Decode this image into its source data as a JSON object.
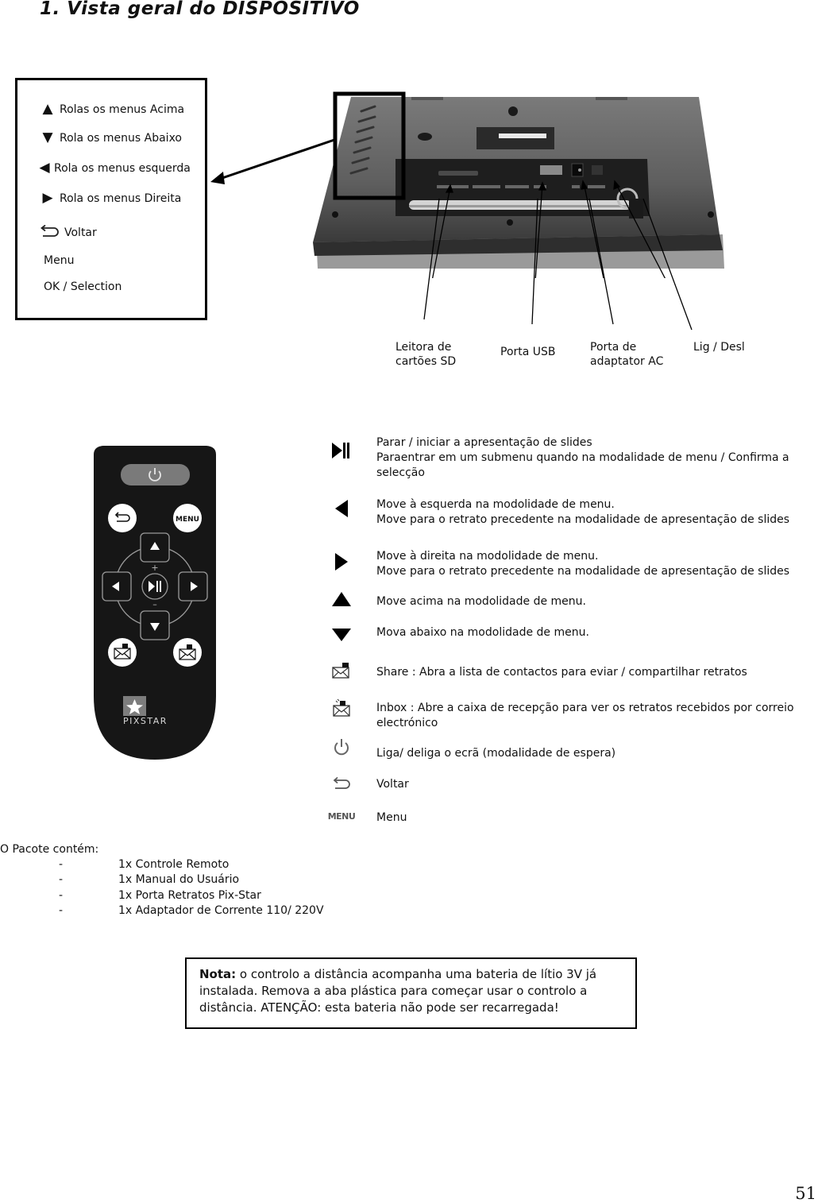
{
  "page": {
    "title": "1. Vista geral do DISPOSITIVO",
    "page_number": "51"
  },
  "device_buttons_legend": {
    "items": [
      {
        "icon": "up-triangle-icon",
        "glyph": "▲",
        "label": "Rolas os menus Acima"
      },
      {
        "icon": "down-triangle-icon",
        "glyph": "▼",
        "label": "Rola os menus Abaixo"
      },
      {
        "icon": "left-triangle-icon",
        "glyph": "◀",
        "label": "Rola os menus esquerda"
      },
      {
        "icon": "right-triangle-icon",
        "glyph": "▶",
        "label": "Rola os menus Direita"
      },
      {
        "icon": "back-arrow-icon",
        "glyph": "⮌",
        "label": "Voltar"
      },
      {
        "icon": "",
        "glyph": "",
        "label": "Menu"
      },
      {
        "icon": "",
        "glyph": "",
        "label": "OK /  Selection"
      }
    ]
  },
  "device_ports": {
    "sd_reader": {
      "line1": "Leitora de",
      "line2": "cartões SD"
    },
    "usb_port": {
      "line1": "Porta USB"
    },
    "ac_adapter": {
      "line1": "Porta de",
      "line2": "adaptator AC"
    },
    "power_switch": {
      "line1": "Lig /  Desl"
    }
  },
  "remote": {
    "menu_button_label": "MENU",
    "brand": "PIXSTAR",
    "plus": "+",
    "minus": "–"
  },
  "remote_functions": [
    {
      "icon": "play-pause-icon",
      "lines": [
        "Parar /  iniciar a apresentação de slides",
        "Paraentrar em um submenu quando na modalidade de menu /  Confirma a",
        "selecção"
      ]
    },
    {
      "icon": "left-triangle-icon",
      "lines": [
        "Move à esquerda na modolidade de menu.",
        "Move para o retrato precedente na modalidade de apresentação de slides"
      ]
    },
    {
      "icon": "right-triangle-icon",
      "lines": [
        "Move à direita na modolidade de menu.",
        "Move para o retrato precedente na modalidade de apresentação de slides"
      ]
    },
    {
      "icon": "up-triangle-icon",
      "lines": [
        "Move acima na modolidade de menu."
      ]
    },
    {
      "icon": "down-triangle-icon",
      "lines": [
        "Mova abaixo na modolidade de menu."
      ]
    },
    {
      "icon": "share-envelope-icon",
      "lines": [
        "Share : Abra a lista de contactos para eviar /  compartilhar retratos"
      ]
    },
    {
      "icon": "inbox-envelope-icon",
      "lines": [
        "Inbox : Abre a caixa de recepção para ver os retratos recebidos por correio",
        "electrónico"
      ]
    },
    {
      "icon": "power-icon",
      "lines": [
        "Liga/ deliga o ecrã (modalidade de espera)"
      ]
    },
    {
      "icon": "back-arrow-icon",
      "lines": [
        "Voltar"
      ]
    },
    {
      "icon": "menu-icon",
      "icon_text": "MENU",
      "lines": [
        "Menu"
      ]
    }
  ],
  "package": {
    "title": "O Pacote contém:",
    "bullet": "-",
    "items": [
      "1x Controle Remoto",
      "1x Manual do Usuário",
      "1x Porta Retratos Pix-Star",
      "1x Adaptador de Corrente 110/ 220V"
    ]
  },
  "note": {
    "label": "Nota:",
    "text": " o controlo a distância acompanha uma bateria de lítio 3V já instalada. Remova a aba plástica para começar usar o controlo a distância. ATENÇÃO: esta bateria não pode ser recarregada!"
  }
}
